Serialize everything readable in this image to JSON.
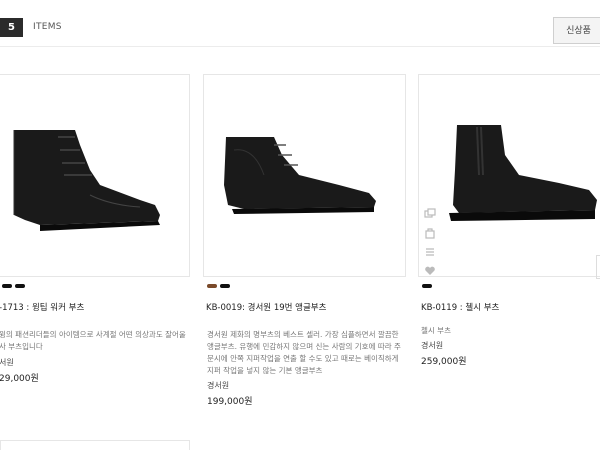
{
  "toolbar": {
    "count": "5",
    "items_label": "ITEMS",
    "sort_label": "신상품"
  },
  "colors": {
    "shoe_dark": "#1a1a1a",
    "swatch_black": "#111111",
    "swatch_brown": "#7a4a2a"
  },
  "products": [
    {
      "name": "-1713 : 윙팁 워커 부츠",
      "desc_lines": [
        "윙의 패션리더들의 아이템으로 사계절 어떤 의상과도 잘어울",
        "사 부츠입니다"
      ],
      "brand": "서원",
      "price": "29,000원",
      "swatches": [
        "swatch_black",
        "swatch_black"
      ]
    },
    {
      "name": "KB-0019: 경서원 19번 앵글부츠",
      "desc_lines": [
        "경서원 제화의 명부츠의 베스트 셀러. 가장 심플하면서 깔끔한",
        "앵글부츠. 유행에 민감하지 않으며 신는 사람의 기호에 따라 주",
        "문시에 안쪽 지퍼작업을 연출 할 수도 있고 때로는 베이직하게",
        "지퍼 작업을 넣지 않는 기본 앵글부츠"
      ],
      "brand": "경서원",
      "price": "199,000원",
      "swatches": [
        "swatch_brown",
        "swatch_black"
      ]
    },
    {
      "name": "KB-0119 : 첼시 부츠",
      "desc_lines": [
        "첼시 부츠"
      ],
      "brand": "경서원",
      "price": "259,000원",
      "swatches": [
        "swatch_black"
      ]
    }
  ],
  "hover_icons": [
    "compare-icon",
    "cart-icon",
    "list-icon",
    "heart-icon"
  ]
}
